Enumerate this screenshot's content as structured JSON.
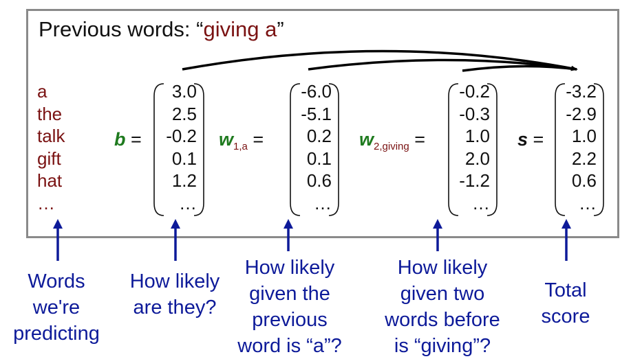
{
  "title": {
    "prefix": "Previous words: “",
    "phrase": "giving a",
    "suffix": "”"
  },
  "words": [
    "a",
    "the",
    "talk",
    "gift",
    "hat",
    "…"
  ],
  "vectors": {
    "b": {
      "name": "b",
      "eq": "=",
      "values": [
        "3.0",
        "2.5",
        "-0.2",
        "0.1",
        "1.2",
        "…"
      ]
    },
    "w1": {
      "name": "w",
      "subscript": "1,a",
      "eq": "=",
      "values": [
        "-6.0",
        "-5.1",
        "0.2",
        "0.1",
        "0.6",
        "…"
      ]
    },
    "w2": {
      "name": "w",
      "subscript": "2,giving",
      "eq": "=",
      "values": [
        "-0.2",
        "-0.3",
        "1.0",
        "2.0",
        "-1.2",
        "…"
      ]
    },
    "s": {
      "name": "s",
      "eq": "=",
      "values": [
        "-3.2",
        "-2.9",
        "1.0",
        "2.2",
        "0.6",
        "…"
      ]
    }
  },
  "captions": {
    "words": [
      "Words",
      "we're",
      "predicting"
    ],
    "b": [
      "How likely",
      "are they?"
    ],
    "w1": [
      "How likely",
      "given the",
      "previous",
      "word is “a”?"
    ],
    "w2": [
      "How likely",
      "given two",
      "words before",
      "is “giving”?"
    ],
    "s": [
      "Total",
      "score"
    ]
  },
  "colors": {
    "word_red": "#7a1212",
    "green": "#1e7a1e",
    "caption_blue": "#0d1a99",
    "frame_gray": "#8a8a8a"
  }
}
